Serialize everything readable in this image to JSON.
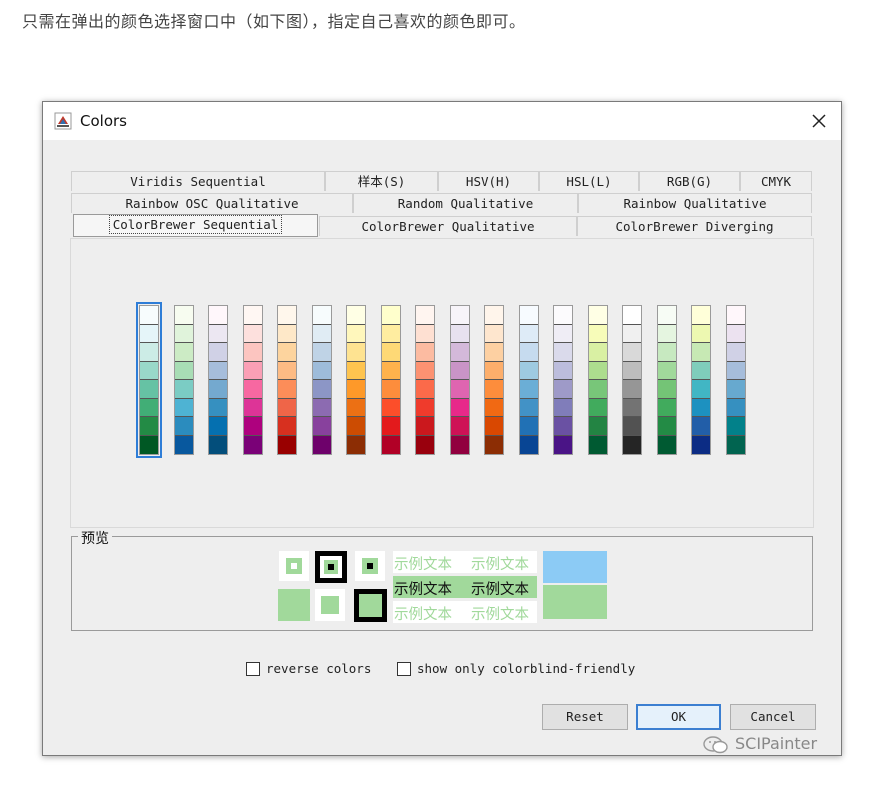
{
  "article": {
    "text": "只需在弹出的颜色选择窗口中（如下图），指定自己喜欢的颜色即可。"
  },
  "dialog": {
    "title": "Colors",
    "close_icon": "close-icon",
    "app_icon": "java-cup-icon"
  },
  "tabs": {
    "row1": [
      "Viridis Sequential",
      "样本(S)",
      "HSV(H)",
      "HSL(L)",
      "RGB(G)",
      "CMYK"
    ],
    "row2": [
      "Rainbow OSC Qualitative",
      "Random Qualitative",
      "Rainbow Qualitative"
    ],
    "row3": [
      "ColorBrewer Sequential",
      "ColorBrewer Qualitative",
      "ColorBrewer Diverging"
    ],
    "selected": "ColorBrewer Sequential"
  },
  "palettes": [
    [
      "#f7fcfd",
      "#e5f5f9",
      "#ccece6",
      "#99d8c9",
      "#66c2a4",
      "#41ae76",
      "#238b45",
      "#005824"
    ],
    [
      "#f7fcf0",
      "#e0f3db",
      "#ccebc5",
      "#a8ddb5",
      "#7bccc4",
      "#4eb3d3",
      "#2b8cbe",
      "#08589e"
    ],
    [
      "#fff7fb",
      "#ece7f2",
      "#d0d1e6",
      "#a6bddb",
      "#74a9cf",
      "#3690c0",
      "#0570b0",
      "#034e7b"
    ],
    [
      "#fff7f3",
      "#fde0dd",
      "#fcc5c0",
      "#fa9fb5",
      "#f768a1",
      "#dd3497",
      "#ae017e",
      "#7a0177"
    ],
    [
      "#fff7ec",
      "#fee8c8",
      "#fdd49e",
      "#fdbb84",
      "#fc8d59",
      "#ef6548",
      "#d7301f",
      "#990000"
    ],
    [
      "#f7fcfd",
      "#e0ecf4",
      "#bfd3e6",
      "#9ebcda",
      "#8c96c6",
      "#8c6bb1",
      "#88419d",
      "#6e016b"
    ],
    [
      "#ffffe5",
      "#fff7bc",
      "#fee391",
      "#fec44f",
      "#fe9929",
      "#ec7014",
      "#cc4c02",
      "#8c2d04"
    ],
    [
      "#ffffcc",
      "#ffeda0",
      "#fed976",
      "#feb24c",
      "#fd8d3c",
      "#fc4e2a",
      "#e31a1c",
      "#b10026"
    ],
    [
      "#fff5f0",
      "#fee0d2",
      "#fcbba1",
      "#fc9272",
      "#fb6a4a",
      "#ef3b2c",
      "#cb181d",
      "#99000d"
    ],
    [
      "#f7f4f9",
      "#e7e1ef",
      "#d4b9da",
      "#c994c7",
      "#df65b0",
      "#e7298a",
      "#ce1256",
      "#91003f"
    ],
    [
      "#fff5eb",
      "#fee6ce",
      "#fdd0a2",
      "#fdae6b",
      "#fd8d3c",
      "#f16913",
      "#d94801",
      "#8c2d04"
    ],
    [
      "#f7fbff",
      "#deebf7",
      "#c6dbef",
      "#9ecae1",
      "#6baed6",
      "#4292c6",
      "#2171b5",
      "#084594"
    ],
    [
      "#fcfbfd",
      "#efedf5",
      "#dadaeb",
      "#bcbddc",
      "#9e9ac8",
      "#807dba",
      "#6a51a3",
      "#4a1486"
    ],
    [
      "#ffffe5",
      "#f7fcb9",
      "#d9f0a3",
      "#addd8e",
      "#78c679",
      "#41ab5d",
      "#238443",
      "#005a32"
    ],
    [
      "#ffffff",
      "#f0f0f0",
      "#d9d9d9",
      "#bdbdbd",
      "#969696",
      "#737373",
      "#525252",
      "#252525"
    ],
    [
      "#f7fcf5",
      "#e5f5e0",
      "#c7e9c0",
      "#a1d99b",
      "#74c476",
      "#41ab5d",
      "#238b45",
      "#005a32"
    ],
    [
      "#ffffd9",
      "#edf8b1",
      "#c7e9b4",
      "#7fcdbb",
      "#41b6c4",
      "#1d91c0",
      "#225ea8",
      "#0c2c84"
    ],
    [
      "#fff7fb",
      "#ece2f0",
      "#d0d1e6",
      "#a6bddb",
      "#67a9cf",
      "#3690c0",
      "#02818a",
      "#016450"
    ]
  ],
  "selected_palette_index": 0,
  "preview": {
    "label": "预览",
    "sample_text": "示例文本",
    "colors": {
      "green": "#a1d99b",
      "black": "#000000",
      "white": "#ffffff",
      "blue": "#8ccbf5"
    }
  },
  "checkboxes": {
    "reverse": "reverse colors",
    "colorblind": "show only colorblind-friendly"
  },
  "buttons": {
    "reset": "Reset",
    "ok": "OK",
    "cancel": "Cancel"
  },
  "watermark": {
    "text": "SCIPainter",
    "icon": "wechat-icon"
  }
}
